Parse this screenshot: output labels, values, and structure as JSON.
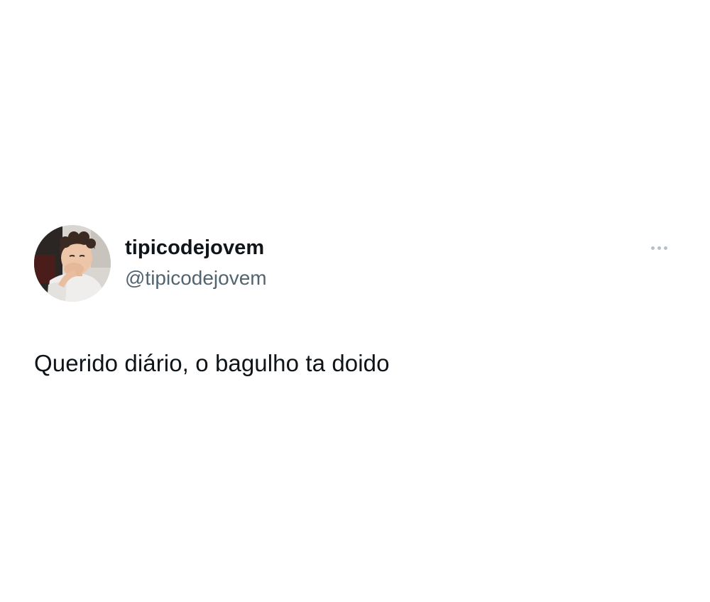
{
  "tweet": {
    "author": {
      "display_name": "tipicodejovem",
      "handle": "@tipicodejovem"
    },
    "text": "Querido diário, o bagulho ta doido",
    "more_icon": "more-horizontal-icon"
  }
}
